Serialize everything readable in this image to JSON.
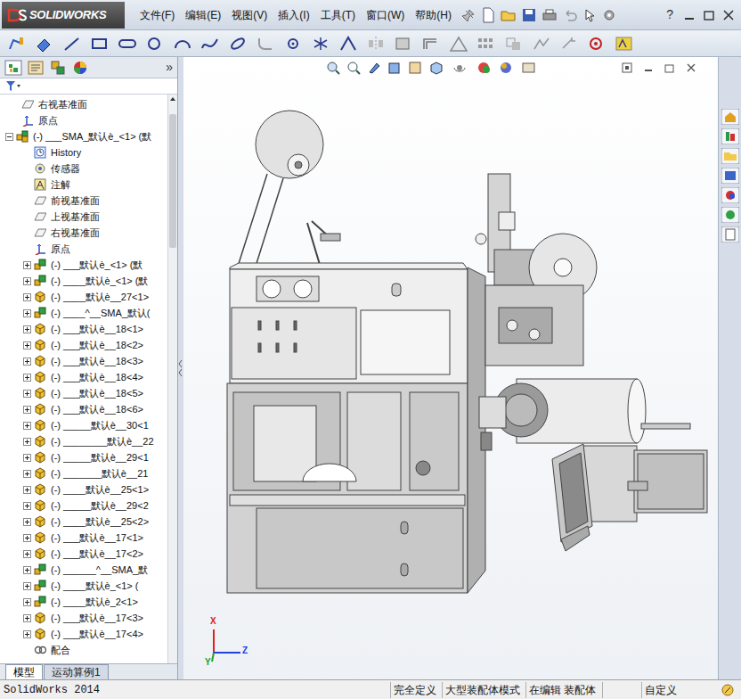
{
  "app": {
    "logo": "SOLIDWORKS",
    "help": "?"
  },
  "menu": [
    {
      "label": "文件(F)"
    },
    {
      "label": "编辑(E)"
    },
    {
      "label": "视图(V)"
    },
    {
      "label": "插入(I)"
    },
    {
      "label": "工具(T)"
    },
    {
      "label": "窗口(W)"
    },
    {
      "label": "帮助(H)"
    }
  ],
  "panel": {
    "more": "»"
  },
  "tree": {
    "before": [
      {
        "label": "右视基准面",
        "kind": "plane"
      },
      {
        "label": "原点",
        "kind": "origin"
      }
    ],
    "root": {
      "label": "(-) ___SMA_默认è_<1> (默",
      "kind": "asm",
      "expanded": true,
      "children": [
        {
          "label": "History",
          "kind": "history"
        },
        {
          "label": "传感器",
          "kind": "sensor"
        },
        {
          "label": "注解",
          "kind": "annotation"
        },
        {
          "label": "前视基准面",
          "kind": "plane"
        },
        {
          "label": "上视基准面",
          "kind": "plane"
        },
        {
          "label": "右视基准面",
          "kind": "plane"
        },
        {
          "label": "原点",
          "kind": "origin"
        },
        {
          "label": "(-) ___默认è_<1> (默",
          "kind": "subasm",
          "expanded": false
        },
        {
          "label": "(-) ____默认è_<1> (默",
          "kind": "subasm",
          "expanded": false
        },
        {
          "label": "(-) ____默认è__27<1>",
          "kind": "part",
          "expanded": false
        },
        {
          "label": "(-) ____^__SMA_默认(",
          "kind": "subasm",
          "expanded": false
        },
        {
          "label": "(-) ___默认è__18<1>",
          "kind": "part",
          "expanded": false
        },
        {
          "label": "(-) ___默认è__18<2>",
          "kind": "part",
          "expanded": false
        },
        {
          "label": "(-) ___默认è__18<3>",
          "kind": "part",
          "expanded": false
        },
        {
          "label": "(-) ___默认è__18<4>",
          "kind": "part",
          "expanded": false
        },
        {
          "label": "(-) ___默认è__18<5>",
          "kind": "part",
          "expanded": false
        },
        {
          "label": "(-) ___默认è__18<6>",
          "kind": "part",
          "expanded": false
        },
        {
          "label": "(-) _____默认è__30<1",
          "kind": "part",
          "expanded": false
        },
        {
          "label": "(-) ________默认è__22",
          "kind": "part",
          "expanded": false
        },
        {
          "label": "(-) _____默认è__29<1",
          "kind": "part",
          "expanded": false
        },
        {
          "label": "(-) _______默认è__21",
          "kind": "part",
          "expanded": false
        },
        {
          "label": "(-) ____默认è__25<1>",
          "kind": "part",
          "expanded": false
        },
        {
          "label": "(-) _____默认è__29<2",
          "kind": "part",
          "expanded": false
        },
        {
          "label": "(-) ____默认è__25<2>",
          "kind": "part",
          "expanded": false
        },
        {
          "label": "(-) ___默认è__17<1>",
          "kind": "part",
          "expanded": false
        },
        {
          "label": "(-) ___默认è__17<2>",
          "kind": "part",
          "expanded": false
        },
        {
          "label": "(-) ______^__SMA_默",
          "kind": "subasm",
          "expanded": false
        },
        {
          "label": "(-) ____默认è_<1> (",
          "kind": "subasm",
          "expanded": false
        },
        {
          "label": "(-) ____默认è_2<1>",
          "kind": "subasm",
          "expanded": false
        },
        {
          "label": "(-) ___默认è__17<3>",
          "kind": "part",
          "expanded": false
        },
        {
          "label": "(-) ___默认è__17<4>",
          "kind": "part",
          "expanded": false
        },
        {
          "label": "配合",
          "kind": "mates"
        }
      ]
    }
  },
  "bottom_tabs": [
    {
      "label": "模型",
      "selected": true
    },
    {
      "label": "运动算例1",
      "selected": false
    }
  ],
  "triad": [
    {
      "label": "X",
      "color": "#e02020"
    },
    {
      "label": "Z",
      "color": "#2040e0"
    },
    {
      "label": "Y",
      "color": "#20a020"
    }
  ],
  "status_bar": {
    "app": "SolidWorks 2014",
    "fields": [
      "完全定义",
      "大型装配体模式",
      "在编辑 装配体",
      "",
      "自定义"
    ]
  }
}
